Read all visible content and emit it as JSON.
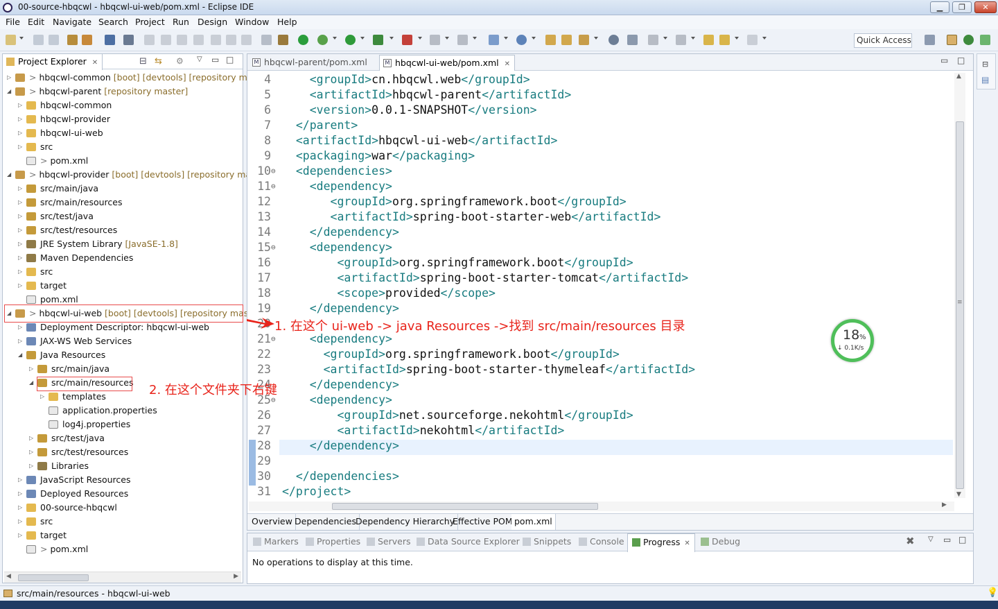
{
  "window": {
    "title": "00-source-hbqcwl - hbqcwl-ui-web/pom.xml - Eclipse IDE"
  },
  "menu": [
    "File",
    "Edit",
    "Navigate",
    "Search",
    "Project",
    "Run",
    "Design",
    "Window",
    "Help"
  ],
  "toolbar": {
    "quick_access": "Quick Access"
  },
  "explorer": {
    "tab": "Project Explorer",
    "rows": [
      {
        "exp": "▷",
        "label": "hbqcwl-common",
        "deco": " [boot] [devtools] [repository mas",
        "prefix": "> "
      },
      {
        "exp": "◢",
        "label": "hbqcwl-parent",
        "deco": " [repository master]",
        "prefix": "> "
      },
      {
        "exp": "▷",
        "label": "hbqcwl-common",
        "deco": "",
        "prefix": ""
      },
      {
        "exp": "▷",
        "label": "hbqcwl-provider",
        "deco": "",
        "prefix": ""
      },
      {
        "exp": "▷",
        "label": "hbqcwl-ui-web",
        "deco": "",
        "prefix": ""
      },
      {
        "exp": "▷",
        "label": "src",
        "deco": "",
        "prefix": ""
      },
      {
        "exp": "",
        "label": "pom.xml",
        "deco": "",
        "prefix": "> "
      },
      {
        "exp": "◢",
        "label": "hbqcwl-provider",
        "deco": " [boot] [devtools] [repository mas",
        "prefix": "> "
      },
      {
        "exp": "▷",
        "label": "src/main/java",
        "deco": "",
        "prefix": ""
      },
      {
        "exp": "▷",
        "label": "src/main/resources",
        "deco": "",
        "prefix": ""
      },
      {
        "exp": "▷",
        "label": "src/test/java",
        "deco": "",
        "prefix": ""
      },
      {
        "exp": "▷",
        "label": "src/test/resources",
        "deco": "",
        "prefix": ""
      },
      {
        "exp": "▷",
        "label": "JRE System Library",
        "deco": " [JavaSE-1.8]",
        "prefix": ""
      },
      {
        "exp": "▷",
        "label": "Maven Dependencies",
        "deco": "",
        "prefix": ""
      },
      {
        "exp": "▷",
        "label": "src",
        "deco": "",
        "prefix": ""
      },
      {
        "exp": "▷",
        "label": "target",
        "deco": "",
        "prefix": ""
      },
      {
        "exp": "",
        "label": "pom.xml",
        "deco": "",
        "prefix": ""
      },
      {
        "exp": "◢",
        "label": "hbqcwl-ui-web",
        "deco": " [boot] [devtools] [repository maste",
        "prefix": "> "
      },
      {
        "exp": "▷",
        "label": "Deployment Descriptor: hbqcwl-ui-web",
        "deco": "",
        "prefix": ""
      },
      {
        "exp": "▷",
        "label": "JAX-WS Web Services",
        "deco": "",
        "prefix": ""
      },
      {
        "exp": "◢",
        "label": "Java Resources",
        "deco": "",
        "prefix": ""
      },
      {
        "exp": "▷",
        "label": "src/main/java",
        "deco": "",
        "prefix": ""
      },
      {
        "exp": "◢",
        "label": "src/main/resources",
        "deco": "",
        "prefix": ""
      },
      {
        "exp": "▷",
        "label": "templates",
        "deco": "",
        "prefix": ""
      },
      {
        "exp": "",
        "label": "application.properties",
        "deco": "",
        "prefix": ""
      },
      {
        "exp": "",
        "label": "log4j.properties",
        "deco": "",
        "prefix": ""
      },
      {
        "exp": "▷",
        "label": "src/test/java",
        "deco": "",
        "prefix": ""
      },
      {
        "exp": "▷",
        "label": "src/test/resources",
        "deco": "",
        "prefix": ""
      },
      {
        "exp": "▷",
        "label": "Libraries",
        "deco": "",
        "prefix": ""
      },
      {
        "exp": "▷",
        "label": "JavaScript Resources",
        "deco": "",
        "prefix": ""
      },
      {
        "exp": "▷",
        "label": "Deployed Resources",
        "deco": "",
        "prefix": ""
      },
      {
        "exp": "▷",
        "label": "00-source-hbqcwl",
        "deco": "",
        "prefix": ""
      },
      {
        "exp": "▷",
        "label": "src",
        "deco": "",
        "prefix": ""
      },
      {
        "exp": "▷",
        "label": "target",
        "deco": "",
        "prefix": ""
      },
      {
        "exp": "",
        "label": "pom.xml",
        "deco": "",
        "prefix": "> "
      }
    ]
  },
  "editor": {
    "tabs": [
      {
        "label": "hbqcwl-parent/pom.xml",
        "active": false
      },
      {
        "label": "hbqcwl-ui-web/pom.xml",
        "active": true
      }
    ],
    "lines": [
      {
        "n": "4",
        "fold": "",
        "code": "    <groupId>cn.hbqcwl.web</groupId>"
      },
      {
        "n": "5",
        "fold": "",
        "code": "    <artifactId>hbqcwl-parent</artifactId>"
      },
      {
        "n": "6",
        "fold": "",
        "code": "    <version>0.0.1-SNAPSHOT</version>"
      },
      {
        "n": "7",
        "fold": "",
        "code": "  </parent>"
      },
      {
        "n": "8",
        "fold": "",
        "code": "  <artifactId>hbqcwl-ui-web</artifactId>"
      },
      {
        "n": "9",
        "fold": "",
        "code": "  <packaging>war</packaging>"
      },
      {
        "n": "10",
        "fold": "⊖",
        "code": "  <dependencies>"
      },
      {
        "n": "11",
        "fold": "⊖",
        "code": "    <dependency>"
      },
      {
        "n": "12",
        "fold": "",
        "code": "       <groupId>org.springframework.boot</groupId>"
      },
      {
        "n": "13",
        "fold": "",
        "code": "       <artifactId>spring-boot-starter-web</artifactId>"
      },
      {
        "n": "14",
        "fold": "",
        "code": "    </dependency>"
      },
      {
        "n": "15",
        "fold": "⊖",
        "code": "    <dependency>"
      },
      {
        "n": "16",
        "fold": "",
        "code": "        <groupId>org.springframework.boot</groupId>"
      },
      {
        "n": "17",
        "fold": "",
        "code": "        <artifactId>spring-boot-starter-tomcat</artifactId>"
      },
      {
        "n": "18",
        "fold": "",
        "code": "        <scope>provided</scope>"
      },
      {
        "n": "19",
        "fold": "",
        "code": "    </dependency>"
      },
      {
        "n": "20",
        "fold": "",
        "code": ""
      },
      {
        "n": "21",
        "fold": "⊖",
        "code": "    <dependency>"
      },
      {
        "n": "22",
        "fold": "",
        "code": "      <groupId>org.springframework.boot</groupId>"
      },
      {
        "n": "23",
        "fold": "",
        "code": "      <artifactId>spring-boot-starter-thymeleaf</artifactId>"
      },
      {
        "n": "24",
        "fold": "",
        "code": "    </dependency>"
      },
      {
        "n": "25",
        "fold": "⊖",
        "code": "    <dependency>"
      },
      {
        "n": "26",
        "fold": "",
        "code": "        <groupId>net.sourceforge.nekohtml</groupId>"
      },
      {
        "n": "27",
        "fold": "",
        "code": "        <artifactId>nekohtml</artifactId>"
      },
      {
        "n": "28",
        "fold": "",
        "code": "    </dependency>"
      },
      {
        "n": "29",
        "fold": "",
        "code": ""
      },
      {
        "n": "30",
        "fold": "",
        "code": "  </dependencies>"
      },
      {
        "n": "31",
        "fold": "",
        "code": "</project>"
      }
    ],
    "bottom_tabs": [
      "Overview",
      "Dependencies",
      "Dependency Hierarchy",
      "Effective POM",
      "pom.xml"
    ]
  },
  "annotations": {
    "step1": "1. 在这个 ui-web -> java Resources ->找到 src/main/resources 目录",
    "step2": "2. 在这个文件夹下右键"
  },
  "net_widget": {
    "percent": "18",
    "unit": "%",
    "speed": "↓ 0.1K/s"
  },
  "bottom_panel": {
    "tabs": [
      "Markers",
      "Properties",
      "Servers",
      "Data Source Explorer",
      "Snippets",
      "Console",
      "Progress",
      "Debug"
    ],
    "active": "Progress",
    "message": "No operations to display at this time."
  },
  "status": {
    "text": "src/main/resources - hbqcwl-ui-web"
  },
  "colors": {
    "tag": "#177b7f",
    "annotation": "#e8231a",
    "current_line": "#e8f2fe"
  }
}
